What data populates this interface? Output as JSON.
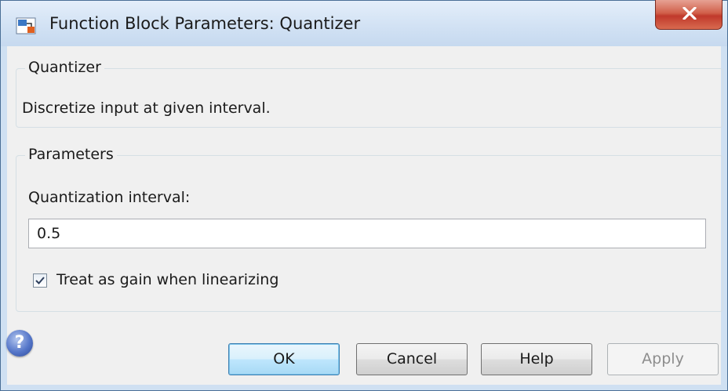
{
  "window": {
    "title": "Function Block Parameters: Quantizer",
    "close_icon": "close-x-icon"
  },
  "block_group": {
    "legend": "Quantizer",
    "description": "Discretize input at given interval."
  },
  "parameters_group": {
    "legend": "Parameters",
    "interval_label": "Quantization interval:",
    "interval_value": "0.5",
    "linearize_label": "Treat as gain when linearizing",
    "linearize_checked": true
  },
  "footer": {
    "help_icon": "question-mark-icon",
    "help_glyph": "?",
    "ok_label": "OK",
    "cancel_label": "Cancel",
    "help_label": "Help",
    "apply_label": "Apply"
  },
  "colors": {
    "title_bar": "#d2e2f4",
    "close_button": "#c0392b",
    "default_button": "#bee6fd"
  }
}
